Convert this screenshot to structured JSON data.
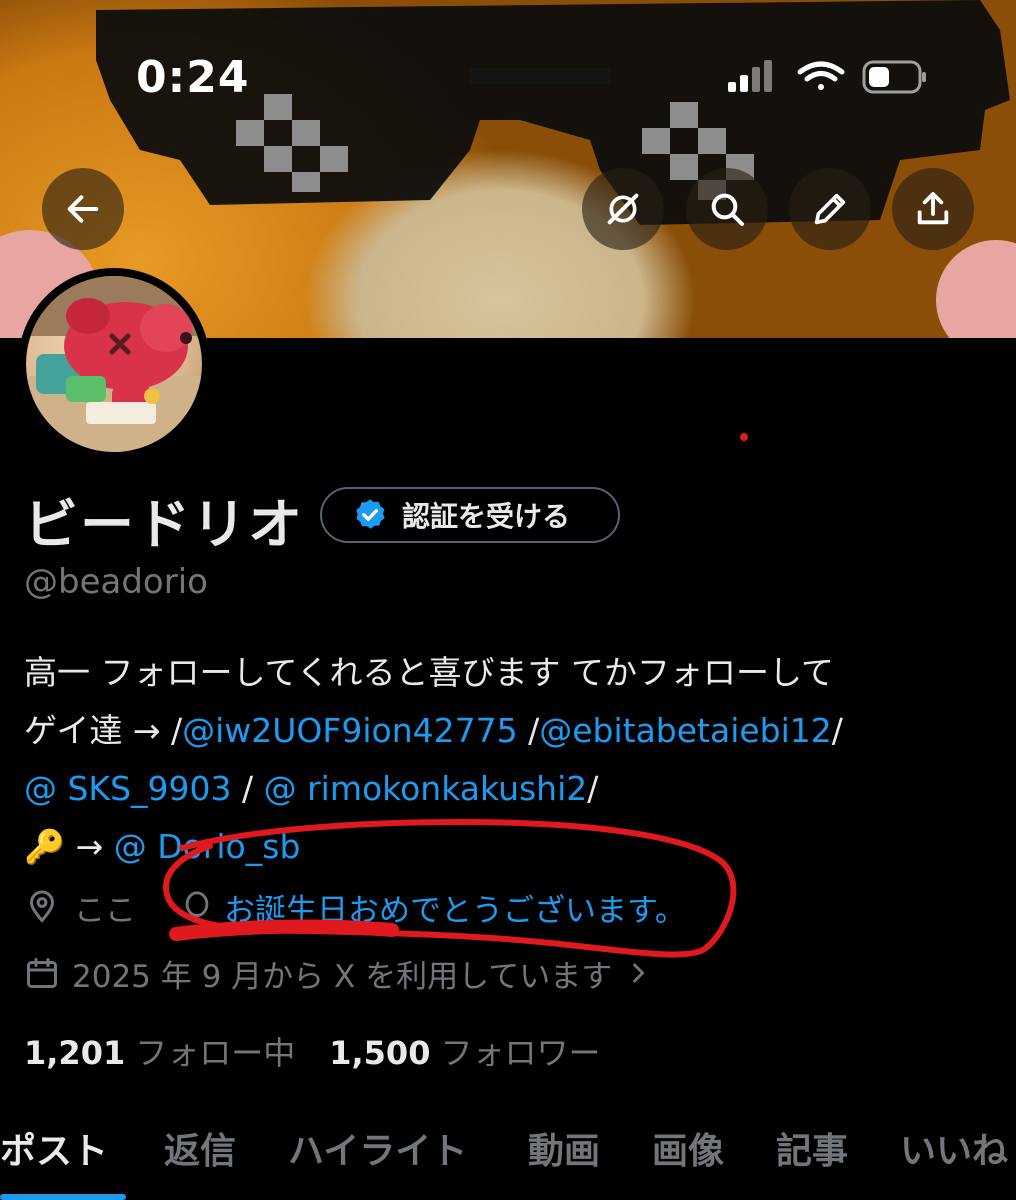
{
  "status_bar": {
    "time": "0:24"
  },
  "header": {
    "back_icon": "arrow-left-icon",
    "actions": [
      "grok-icon",
      "search-icon",
      "edit-icon",
      "share-icon"
    ]
  },
  "profile": {
    "display_name": "ビードリオ",
    "verify_label": "認証を受ける",
    "handle": "@beadorio",
    "bio": {
      "line1": "高一 フォローしてくれると喜びます てかフォローして",
      "line2_prefix": "ゲイ達 → /",
      "mention1": "@iw2UOF9ion42775",
      "sep1": " /",
      "mention2": "@ebitabetaiebi12",
      "sep2": "/",
      "mention3": "@ SKS_9903",
      "sep3": " / ",
      "mention4": "@ rimokonkakushi2",
      "sep4": "/",
      "key_emoji": "🔑",
      "arrow": " → ",
      "mention5": "@ Dorio_sb"
    },
    "location": "ここ",
    "birthday": "お誕生日おめでとうございます。",
    "joined": "2025 年 9 月から X を利用しています",
    "following_count": "1,201",
    "following_label": "フォロー中",
    "followers_count": "1,500",
    "followers_label": "フォロワー"
  },
  "tabs": [
    "ポスト",
    "返信",
    "ハイライト",
    "動画",
    "画像",
    "記事",
    "いいね"
  ],
  "colors": {
    "accent": "#1d9bf0",
    "muted": "#71767b",
    "annotation": "#e0191e"
  }
}
